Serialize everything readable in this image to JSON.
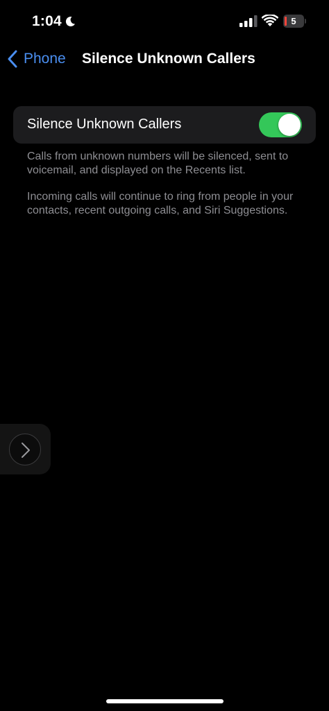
{
  "status_bar": {
    "time": "1:04",
    "battery_level": "5",
    "icons": [
      "moon-icon",
      "cellular-signal-icon",
      "wifi-icon",
      "battery-icon"
    ]
  },
  "nav": {
    "back_label": "Phone",
    "title": "Silence Unknown Callers"
  },
  "setting": {
    "label": "Silence Unknown Callers",
    "enabled": true
  },
  "footer": {
    "line1": "Calls from unknown numbers will be silenced, sent to voicemail, and displayed on the Recents list.",
    "line2": "Incoming calls will continue to ring from people in your contacts, recent outgoing calls, and Siri Suggestions."
  },
  "colors": {
    "background": "#000000",
    "group_background": "#1c1c1e",
    "accent_blue": "#4a8ef0",
    "toggle_on": "#34c759",
    "secondary_text": "#8e8e93"
  }
}
